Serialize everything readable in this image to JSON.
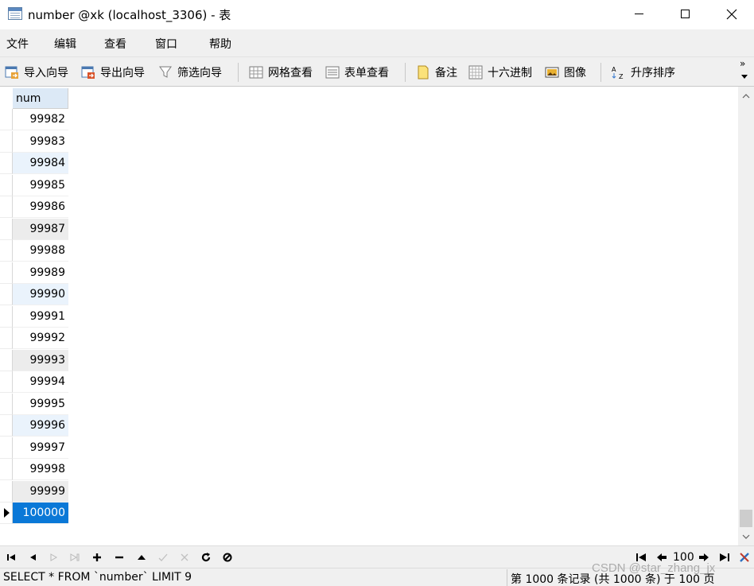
{
  "window": {
    "title": "number @xk (localhost_3306) - 表"
  },
  "menu": {
    "items": [
      "文件",
      "编辑",
      "查看",
      "窗口",
      "帮助"
    ]
  },
  "toolbar": {
    "buttons": [
      {
        "label": "导入向导",
        "icon": "import-wizard-icon"
      },
      {
        "label": "导出向导",
        "icon": "export-wizard-icon"
      },
      {
        "label": "筛选向导",
        "icon": "filter-icon"
      },
      {
        "label": "网格查看",
        "icon": "grid-view-icon"
      },
      {
        "label": "表单查看",
        "icon": "form-view-icon"
      },
      {
        "label": "备注",
        "icon": "memo-icon"
      },
      {
        "label": "十六进制",
        "icon": "hex-icon"
      },
      {
        "label": "图像",
        "icon": "image-icon"
      },
      {
        "label": "升序排序",
        "icon": "sort-ascending-icon"
      }
    ],
    "more": "»"
  },
  "grid": {
    "column": "num",
    "rows": [
      "99982",
      "99983",
      "99984",
      "99985",
      "99986",
      "99987",
      "99988",
      "99989",
      "99990",
      "99991",
      "99992",
      "99993",
      "99994",
      "99995",
      "99996",
      "99997",
      "99998",
      "99999",
      "100000"
    ],
    "selected_row_index": 18
  },
  "navigation": {
    "page": "100"
  },
  "status": {
    "sql": "SELECT * FROM `number` LIMIT 9",
    "count": "第 1000 条记录 (共 1000 条) 于 100 页"
  },
  "watermark": "CSDN @star_zhang_jx",
  "colors": {
    "selection": "#0a78d7",
    "header_bg": "#dce9f6",
    "chrome_bg": "#f0f0f0"
  }
}
